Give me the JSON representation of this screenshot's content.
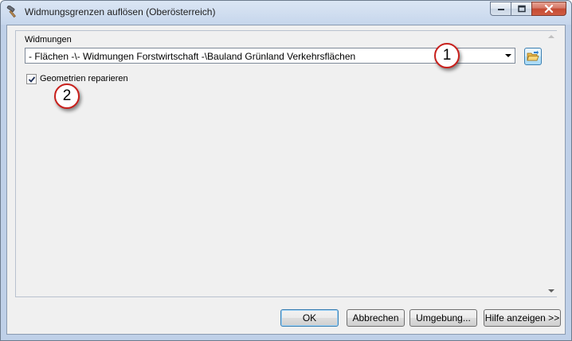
{
  "window": {
    "title": "Widmungsgrenzen auflösen (Oberösterreich)"
  },
  "form": {
    "widmungen_label": "Widmungen",
    "widmungen_value": "- Flächen -\\- Widmungen Forstwirtschaft -\\Bauland Grünland Verkehrsflächen",
    "geometrien_label": "Geometrien reparieren",
    "geometrien_checked": true
  },
  "callouts": {
    "one": "1",
    "two": "2"
  },
  "buttons": {
    "ok": "OK",
    "cancel": "Abbrechen",
    "environment": "Umgebung...",
    "help": "Hilfe anzeigen >>"
  },
  "icons": {
    "title": "hammer-icon",
    "browse": "folder-open-icon",
    "check": "checkmark-icon"
  },
  "colors": {
    "callout_border": "#c8201c",
    "close_button": "#c44a33",
    "default_button_border": "#3c7fb1"
  }
}
